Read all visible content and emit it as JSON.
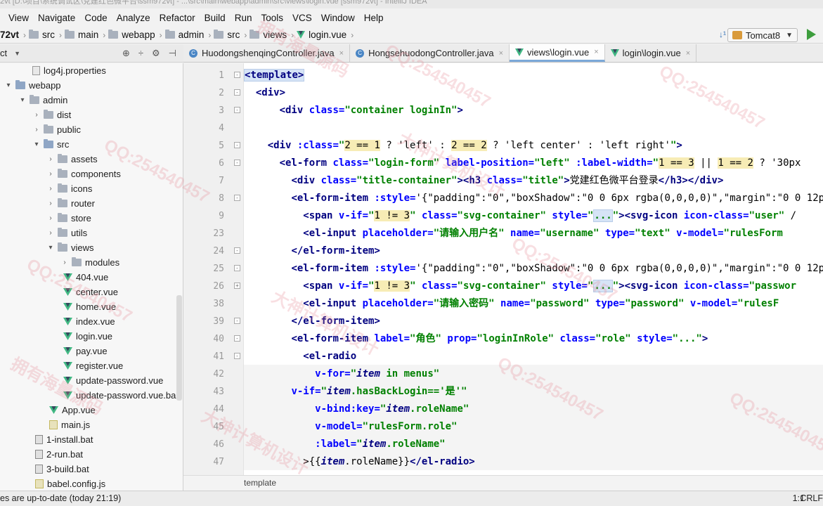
{
  "window": {
    "title": "2vt [D:\\项目\\系统调试区\\党建红色微平台\\ssm972vt] - ...\\src\\main\\webapp\\admin\\src\\views\\login.vue [ssm972vt] - IntelliJ IDEA"
  },
  "menu": [
    "View",
    "Navigate",
    "Code",
    "Analyze",
    "Refactor",
    "Build",
    "Run",
    "Tools",
    "VCS",
    "Window",
    "Help"
  ],
  "breadcrumb": [
    "72vt",
    "src",
    "main",
    "webapp",
    "admin",
    "src",
    "views",
    "login.vue"
  ],
  "run_config": {
    "label": "Tomcat8"
  },
  "project_panel": {
    "label": "ct"
  },
  "tree": [
    {
      "label": "log4j.properties",
      "icon": "properties-file-icon",
      "indent": 46,
      "toggle": ""
    },
    {
      "label": "webapp",
      "icon": "folder-icon",
      "indent": 6,
      "toggle": "▾"
    },
    {
      "label": "admin",
      "icon": "folder-icon",
      "indent": 26,
      "toggle": "▾"
    },
    {
      "label": "dist",
      "icon": "folder-icon",
      "indent": 46,
      "toggle": "›"
    },
    {
      "label": "public",
      "icon": "folder-icon",
      "indent": 46,
      "toggle": "›"
    },
    {
      "label": "src",
      "icon": "folder-icon",
      "indent": 46,
      "toggle": "▾"
    },
    {
      "label": "assets",
      "icon": "folder-icon",
      "indent": 66,
      "toggle": "›"
    },
    {
      "label": "components",
      "icon": "folder-icon",
      "indent": 66,
      "toggle": "›"
    },
    {
      "label": "icons",
      "icon": "folder-icon",
      "indent": 66,
      "toggle": "›"
    },
    {
      "label": "router",
      "icon": "folder-icon",
      "indent": 66,
      "toggle": "›"
    },
    {
      "label": "store",
      "icon": "folder-icon",
      "indent": 66,
      "toggle": "›"
    },
    {
      "label": "utils",
      "icon": "folder-icon",
      "indent": 66,
      "toggle": "›"
    },
    {
      "label": "views",
      "icon": "folder-icon",
      "indent": 66,
      "toggle": "▾"
    },
    {
      "label": "modules",
      "icon": "folder-icon",
      "indent": 86,
      "toggle": "›"
    },
    {
      "label": "404.vue",
      "icon": "vue-file-icon",
      "indent": 90,
      "toggle": ""
    },
    {
      "label": "center.vue",
      "icon": "vue-file-icon",
      "indent": 90,
      "toggle": ""
    },
    {
      "label": "home.vue",
      "icon": "vue-file-icon",
      "indent": 90,
      "toggle": ""
    },
    {
      "label": "index.vue",
      "icon": "vue-file-icon",
      "indent": 90,
      "toggle": ""
    },
    {
      "label": "login.vue",
      "icon": "vue-file-icon",
      "indent": 90,
      "toggle": ""
    },
    {
      "label": "pay.vue",
      "icon": "vue-file-icon",
      "indent": 90,
      "toggle": ""
    },
    {
      "label": "register.vue",
      "icon": "vue-file-icon",
      "indent": 90,
      "toggle": ""
    },
    {
      "label": "update-password.vue",
      "icon": "vue-file-icon",
      "indent": 90,
      "toggle": ""
    },
    {
      "label": "update-password.vue.ba",
      "icon": "vue-file-icon",
      "indent": 90,
      "toggle": ""
    },
    {
      "label": "App.vue",
      "icon": "vue-file-icon",
      "indent": 70,
      "toggle": ""
    },
    {
      "label": "main.js",
      "icon": "js-file-icon",
      "indent": 70,
      "toggle": ""
    },
    {
      "label": "1-install.bat",
      "icon": "bat-file-icon",
      "indent": 50,
      "toggle": ""
    },
    {
      "label": "2-run.bat",
      "icon": "bat-file-icon",
      "indent": 50,
      "toggle": ""
    },
    {
      "label": "3-build.bat",
      "icon": "bat-file-icon",
      "indent": 50,
      "toggle": ""
    },
    {
      "label": "babel.config.js",
      "icon": "js-file-icon",
      "indent": 50,
      "toggle": ""
    }
  ],
  "tabs": [
    {
      "label": "HuodongshenqingController.java",
      "type": "java",
      "active": false
    },
    {
      "label": "HongsehuodongController.java",
      "type": "java",
      "active": false
    },
    {
      "label": "views\\login.vue",
      "type": "vue",
      "active": true
    },
    {
      "label": "login\\login.vue",
      "type": "vue",
      "active": false
    }
  ],
  "line_numbers": [
    "1",
    "2",
    "3",
    "4",
    "5",
    "6",
    "7",
    "8",
    "9",
    "23",
    "24",
    "25",
    "26",
    "38",
    "39",
    "40",
    "41",
    "42",
    "43",
    "44",
    "45",
    "46",
    "47"
  ],
  "code_strings": {
    "l1_template": "template",
    "l7_title": "党建红色微平台登录",
    "l23_placeholder": "\"请输入用户名\"",
    "l38_placeholder": "\"请输入密码\"",
    "l40_label": "\"角色\"",
    "l43_condition": "'是'"
  },
  "editor_breadcrumb": "template",
  "status": {
    "message": "es are up-to-date (today 21:19)",
    "position": "1:1",
    "line_ending": "CRLF"
  },
  "watermarks": [
    "QQ:254540457",
    "拥有海量源码",
    "大神计算机设计"
  ]
}
